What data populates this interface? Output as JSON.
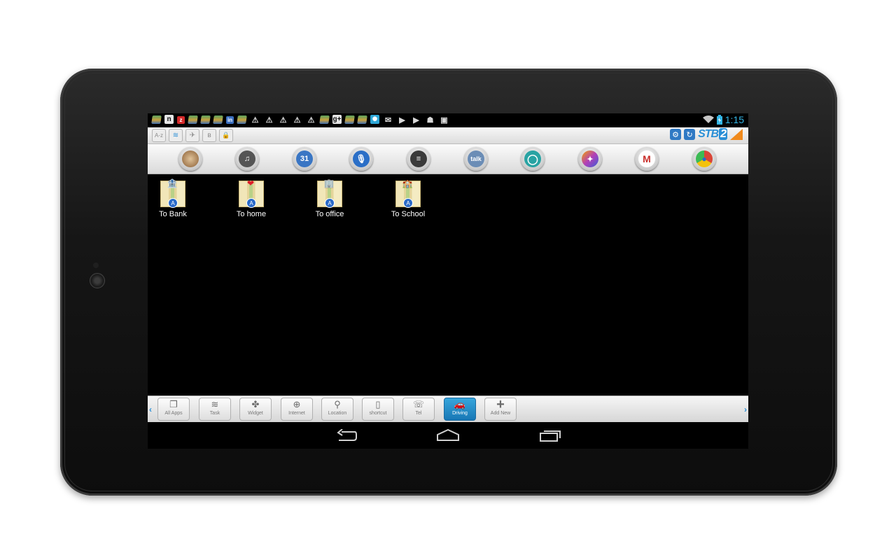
{
  "status_bar": {
    "notification_icons": [
      "stack-icon",
      "n-icon",
      "red-square-icon",
      "stack-icon",
      "stack-icon",
      "stack-icon",
      "linkedin-icon",
      "stack-icon",
      "warning-icon",
      "warning-icon",
      "warning-icon",
      "warning-icon",
      "warning-icon",
      "stack-icon",
      "google-plus-icon",
      "stack-icon",
      "stack-icon",
      "cyan-app-icon",
      "gmail-icon",
      "play-icon",
      "play-icon",
      "android-icon",
      "bag-icon"
    ],
    "time": "1:15"
  },
  "toggle_bar": {
    "toggles": [
      {
        "name": "a-z-toggle",
        "glyph": "A-z"
      },
      {
        "name": "wifi-toggle",
        "glyph": "≋"
      },
      {
        "name": "airplane-toggle",
        "glyph": "✈"
      },
      {
        "name": "bluetooth-toggle",
        "glyph": "ʙ"
      },
      {
        "name": "lock-toggle",
        "glyph": "🔒"
      }
    ],
    "logo_text": "STB",
    "logo_number": "2"
  },
  "dock_apps": [
    {
      "name": "app-photo",
      "color": "#b98b5a",
      "glyph": ""
    },
    {
      "name": "app-music",
      "color": "#555555",
      "glyph": "♫"
    },
    {
      "name": "app-calendar",
      "color": "#3a76c4",
      "glyph": "31"
    },
    {
      "name": "app-voice",
      "color": "#2b6fc7",
      "glyph": "🎙"
    },
    {
      "name": "app-settings",
      "color": "#3a3a3a",
      "glyph": "≡"
    },
    {
      "name": "app-talk",
      "color": "#6b8db6",
      "glyph": "talk"
    },
    {
      "name": "app-camera",
      "color": "#29a3a3",
      "glyph": "◯"
    },
    {
      "name": "app-gallery",
      "color": "#b33fb8",
      "glyph": "✦"
    },
    {
      "name": "app-gmail",
      "color": "#c9302c",
      "glyph": "M"
    },
    {
      "name": "app-chrome",
      "color": "#d94537",
      "glyph": "●"
    }
  ],
  "shortcuts": [
    {
      "label": "To Bank",
      "badge": "🏦"
    },
    {
      "label": "To home",
      "badge": "❤"
    },
    {
      "label": "To office",
      "badge": "🏢"
    },
    {
      "label": "To School",
      "badge": "🏫"
    }
  ],
  "tabs": [
    {
      "label": "All Apps",
      "glyph": "❐"
    },
    {
      "label": "Task",
      "glyph": "≋"
    },
    {
      "label": "Widget",
      "glyph": "✤"
    },
    {
      "label": "Internet",
      "glyph": "⊕"
    },
    {
      "label": "Location",
      "glyph": "⚲"
    },
    {
      "label": "shortcut",
      "glyph": "▯"
    },
    {
      "label": "Tel",
      "glyph": "☏"
    },
    {
      "label": "Driving",
      "glyph": "🚗"
    },
    {
      "label": "Add New",
      "glyph": "+"
    }
  ],
  "active_tab": "Driving",
  "tab_arrows": {
    "left": "‹",
    "right": "›"
  }
}
